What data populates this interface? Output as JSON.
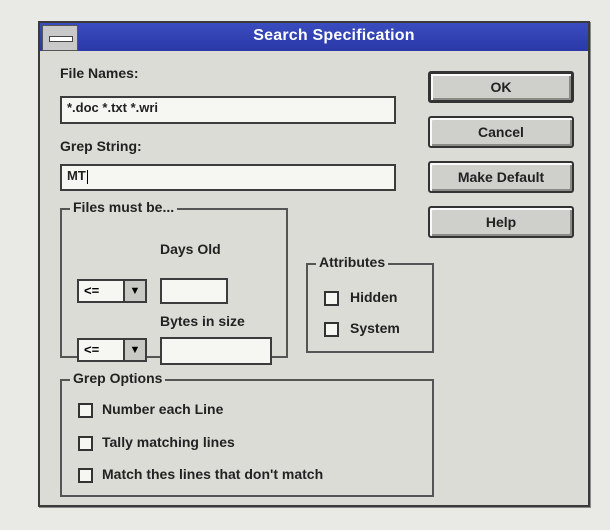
{
  "dialog": {
    "title": "Search Specification",
    "file_names_label": "File Names:",
    "file_names_value": "*.doc *.txt *.wri",
    "grep_string_label": "Grep String:",
    "grep_string_value": "MT",
    "buttons": {
      "ok": "OK",
      "cancel": "Cancel",
      "make_default": "Make Default",
      "help": "Help"
    },
    "files_group": {
      "label": "Files must be...",
      "days_old_label": "Days Old",
      "days_operator": "<=",
      "days_value": "",
      "bytes_label": "Bytes in size",
      "bytes_operator": "<=",
      "bytes_value": ""
    },
    "attributes_group": {
      "label": "Attributes",
      "hidden_label": "Hidden",
      "hidden_checked": false,
      "system_label": "System",
      "system_checked": false
    },
    "grep_options_group": {
      "label": "Grep Options",
      "number_each_line": "Number each Line",
      "tally_matching_lines": "Tally matching lines",
      "match_non_matching": "Match thes lines that don't match"
    }
  }
}
